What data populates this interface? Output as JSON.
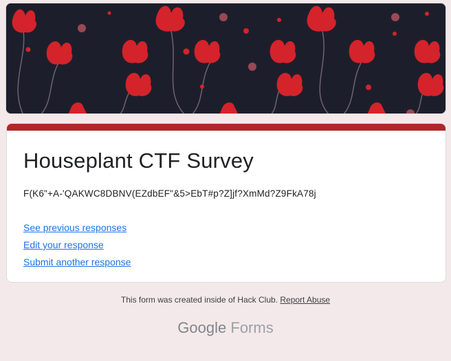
{
  "form": {
    "title": "Houseplant CTF Survey",
    "description": "F(K6\"+A-'QAKWC8DBNV(EZdbEF\"&5>EbT#p?Z]jf?XmMd?Z9FkA78j",
    "links": [
      "See previous responses",
      "Edit your response",
      "Submit another response"
    ]
  },
  "footer": {
    "note": "This form was created inside of Hack Club.",
    "report": "Report Abuse",
    "logo_google": "Google",
    "logo_forms": "Forms"
  },
  "colors": {
    "accent": "#b1262b",
    "banner_bg": "#1c1f2b",
    "flower": "#d4232b",
    "link": "#1a73e8",
    "page_bg": "#f4e9ea"
  },
  "icons": {
    "banner": "floral-pattern"
  }
}
